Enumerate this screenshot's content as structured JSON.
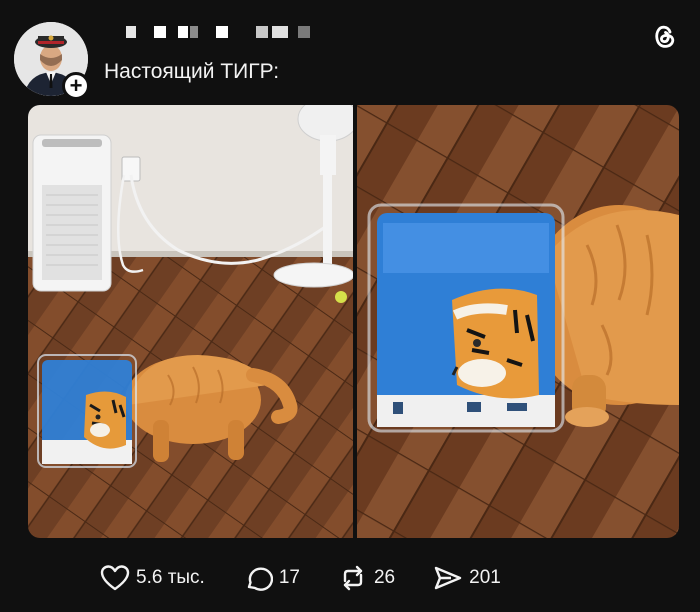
{
  "post": {
    "text": "Настоящий ТИГР:",
    "avatar_icon": "user-avatar",
    "follow_icon": "plus-icon",
    "app_icon": "threads-logo-icon",
    "image_count": 2
  },
  "actions": {
    "likes": {
      "icon": "heart-icon",
      "count": "5.6 тыс."
    },
    "replies": {
      "icon": "comment-icon",
      "count": "17"
    },
    "reposts": {
      "icon": "repost-icon",
      "count": "26"
    },
    "shares": {
      "icon": "share-icon",
      "count": "201"
    }
  },
  "colors": {
    "background": "#101010",
    "text": "#f3f3f3",
    "floor": "#7a4a2a",
    "cat": "#d98c3f",
    "package": "#2f7fd6"
  }
}
